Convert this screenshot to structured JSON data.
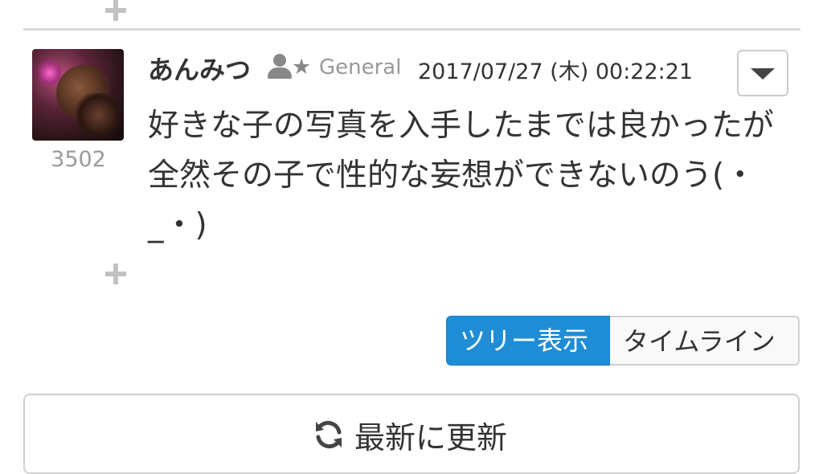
{
  "post": {
    "username": "あんみつ",
    "rank": "General",
    "timestamp": "2017/07/27 (木) 00:22:21",
    "points": "3502",
    "message": "好きな子の写真を入手したまでは良かったが全然その子で性的な妄想ができないのう(・_・)"
  },
  "view_toggle": {
    "tree_label": "ツリー表示",
    "timeline_label": "タイムライン",
    "active": "tree"
  },
  "refresh": {
    "label": "最新に更新"
  },
  "colors": {
    "accent": "#1f8dd6",
    "muted_text": "#999999",
    "border": "#d0d0d0"
  },
  "icons": {
    "expand": "plus-icon",
    "user": "user-icon",
    "rank_star": "star-icon",
    "menu": "caret-down-icon",
    "refresh": "refresh-icon"
  }
}
